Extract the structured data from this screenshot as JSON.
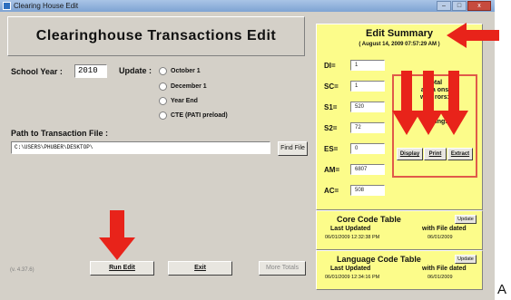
{
  "window": {
    "title": "Clearing House Edit",
    "btn_min": "–",
    "btn_max": "□",
    "btn_close": "x"
  },
  "header": {
    "title": "Clearinghouse Transactions Edit"
  },
  "school_year": {
    "label": "School Year :",
    "value": "2010"
  },
  "update": {
    "label": "Update :",
    "options": [
      "October 1",
      "December 1",
      "Year End",
      "CTE (PATI preload)"
    ]
  },
  "path": {
    "label": "Path to Transaction File :",
    "value": "C:\\USERS\\PHUBER\\DESKTOP\\",
    "find_button": "Find File"
  },
  "buttons": {
    "run_edit": "Run Edit",
    "exit": "Exit",
    "more_totals": "More Totals"
  },
  "version": "(v. 4.37.6)",
  "summary": {
    "title": "Edit Summary",
    "date": "( August 14, 2009  07:57:29 AM )",
    "stats": [
      {
        "label": "DI=",
        "value": "1"
      },
      {
        "label": "SC=",
        "value": "1"
      },
      {
        "label": "S1=",
        "value": "520"
      },
      {
        "label": "S2=",
        "value": "72"
      },
      {
        "label": "ES=",
        "value": "0"
      },
      {
        "label": "AM=",
        "value": "6807"
      },
      {
        "label": "AC=",
        "value": "508"
      }
    ],
    "totals": {
      "line1": "Total",
      "line2": "ansa  ons",
      "line3": "with  rors:",
      "line4": "th  w   ings"
    },
    "display_button": "Display",
    "print_button": "Print",
    "extract_button": "Extract"
  },
  "core_table": {
    "title": "Core Code Table",
    "update": "Update",
    "col1": "Last Updated",
    "col2": "with File dated",
    "last_updated": "06/01/2009  12:32:38 PM",
    "file_dated": "06/01/2009"
  },
  "language_table": {
    "title": "Language Code Table",
    "update": "Update",
    "col1": "Last Updated",
    "col2": "with File dated",
    "last_updated": "06/01/2009  12:34:16 PM",
    "file_dated": "06/01/2009"
  },
  "cutoff_text": "A",
  "colors": {
    "panel_yellow": "#fcfc8a",
    "arrow_red": "#e8231a",
    "totals_border": "#e05a4a"
  }
}
